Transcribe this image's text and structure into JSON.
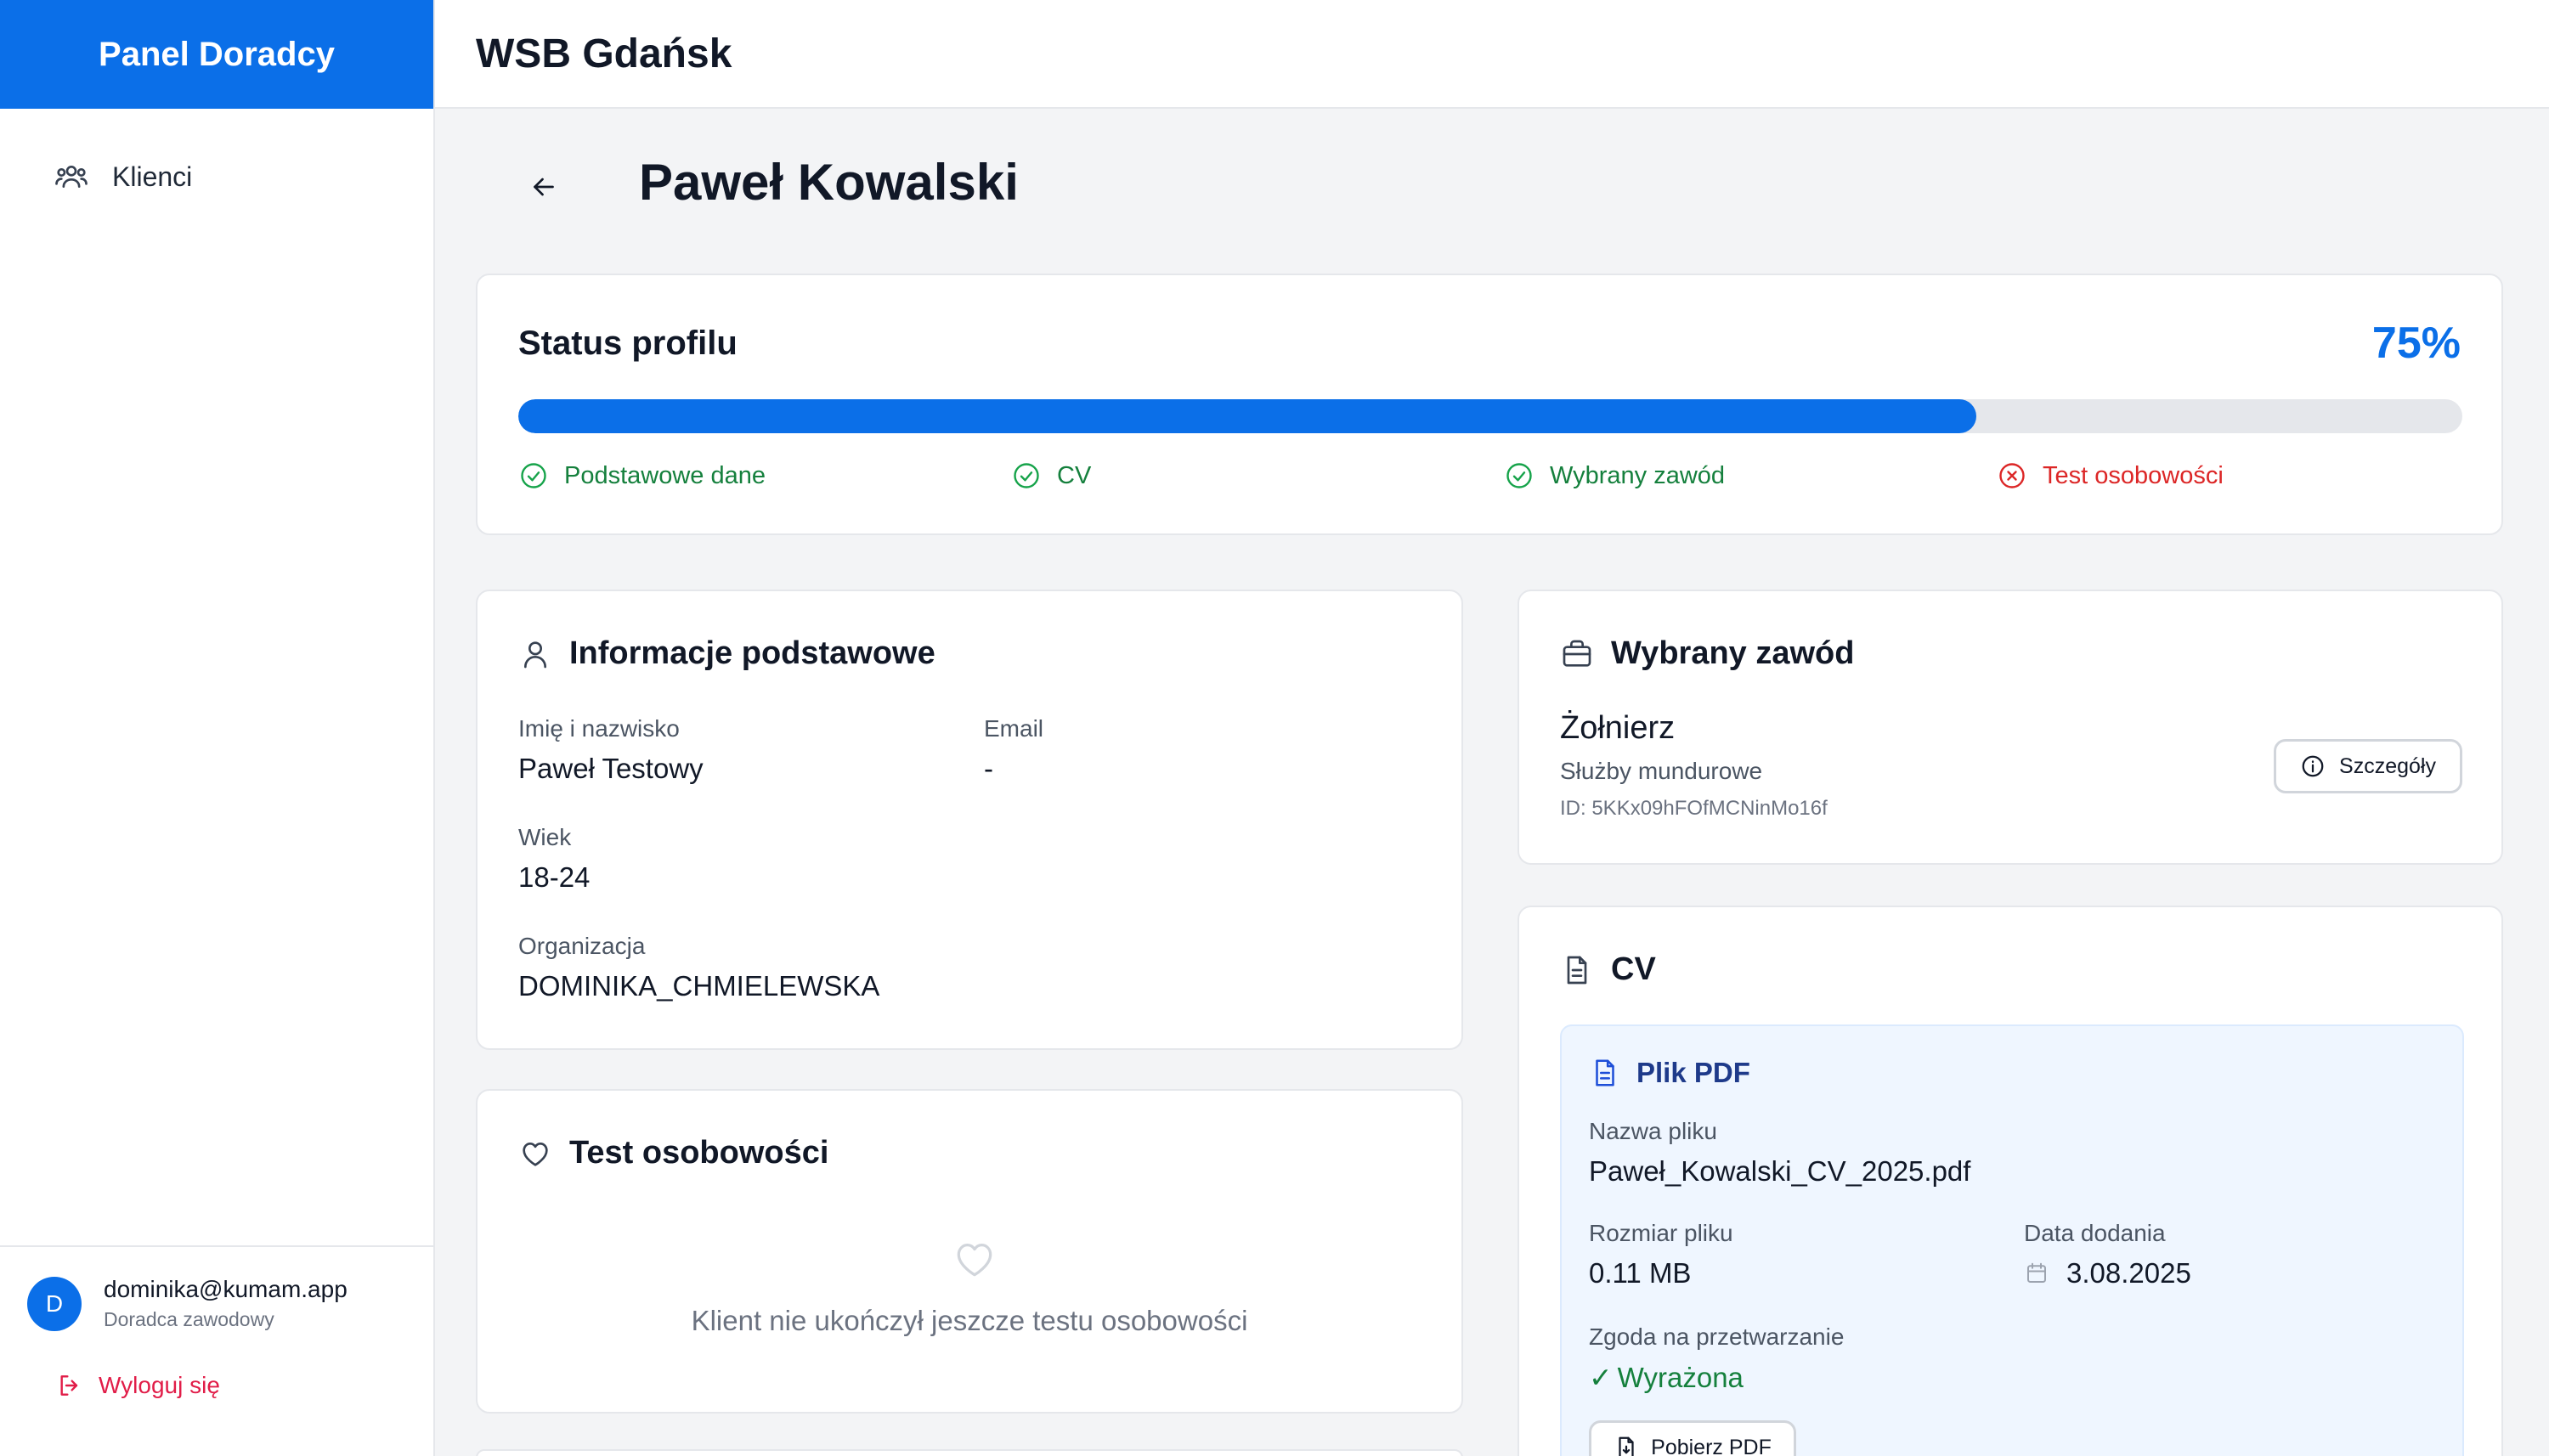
{
  "sidebar": {
    "brand": "Panel Doradcy",
    "nav": [
      {
        "label": "Klienci",
        "icon": "users-icon"
      }
    ],
    "user": {
      "initial": "D",
      "email": "dominika@kumam.app",
      "role": "Doradca zawodowy"
    },
    "logout_label": "Wyloguj się"
  },
  "header": {
    "title": "WSB Gdańsk"
  },
  "page": {
    "title": "Paweł Kowalski",
    "back_icon": "arrow-left-icon"
  },
  "status": {
    "title": "Status profilu",
    "percent_label": "75%",
    "progress": 0.75,
    "steps": [
      {
        "label": "Podstawowe dane",
        "done": true
      },
      {
        "label": "CV",
        "done": true
      },
      {
        "label": "Wybrany zawód",
        "done": true
      },
      {
        "label": "Test osobowości",
        "done": false
      }
    ]
  },
  "basic_info": {
    "title": "Informacje podstawowe",
    "name_label": "Imię i nazwisko",
    "name_value": "Paweł Testowy",
    "email_label": "Email",
    "email_value": "-",
    "age_label": "Wiek",
    "age_value": "18-24",
    "org_label": "Organizacja",
    "org_value": "DOMINIKA_CHMIELEWSKA"
  },
  "personality": {
    "title": "Test osobowości",
    "empty_text": "Klient nie ukończył jeszcze testu osobowości"
  },
  "career": {
    "title": "Wybrany zawód",
    "name": "Żołnierz",
    "category": "Służby mundurowe",
    "id": "ID: 5KKx09hFOfMCNinMo16f",
    "details_label": "Szczegóły"
  },
  "cv": {
    "title": "CV",
    "file_box_title": "Plik PDF",
    "filename_label": "Nazwa pliku",
    "filename": "Paweł_Kowalski_CV_2025.pdf",
    "size_label": "Rozmiar pliku",
    "size": "0.11 MB",
    "date_label": "Data dodania",
    "date": "3.08.2025",
    "consent_label": "Zgoda na przetwarzanie",
    "consent_value": "Wyrażona",
    "download_label": "Pobierz PDF"
  },
  "colors": {
    "accent": "#0b6fe8",
    "success": "#15803d",
    "danger": "#dc2626",
    "logout": "#e11d48"
  }
}
